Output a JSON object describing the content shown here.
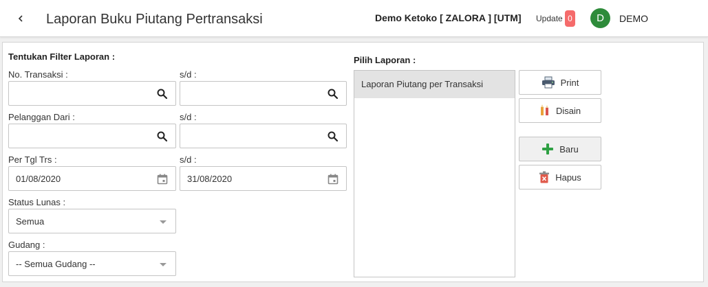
{
  "header": {
    "title": "Laporan Buku Piutang Pertransaksi",
    "company": "Demo Ketoko [ ZALORA ] [UTM]",
    "update_label": "Update",
    "update_count": "0",
    "avatar_initial": "D",
    "username": "DEMO"
  },
  "filter": {
    "section_title": "Tentukan Filter Laporan :",
    "sd_label": "s/d :",
    "no_transaksi_label": "No. Transaksi :",
    "no_transaksi_from": "",
    "no_transaksi_to": "",
    "pelanggan_label": "Pelanggan Dari :",
    "pelanggan_from": "",
    "pelanggan_to": "",
    "tgl_label": "Per Tgl Trs :",
    "tgl_from": "01/08/2020",
    "tgl_to": "31/08/2020",
    "status_label": "Status Lunas :",
    "status_value": "Semua",
    "gudang_label": "Gudang :",
    "gudang_value": "-- Semua Gudang --"
  },
  "report": {
    "section_title": "Pilih Laporan :",
    "items": [
      "Laporan Piutang per Transaksi"
    ]
  },
  "buttons": {
    "print": "Print",
    "disain": "Disain",
    "baru": "Baru",
    "hapus": "Hapus"
  },
  "icons": {
    "back": "chevron-left-icon",
    "search": "search-icon",
    "calendar": "calendar-icon",
    "print": "printer-icon",
    "design": "pencils-icon",
    "add": "plus-icon",
    "delete": "trash-icon"
  },
  "colors": {
    "badge": "#f56b6b",
    "avatar": "#2e8b3a",
    "add_icon": "#2ea043",
    "delete_icon": "#e05a4b"
  }
}
